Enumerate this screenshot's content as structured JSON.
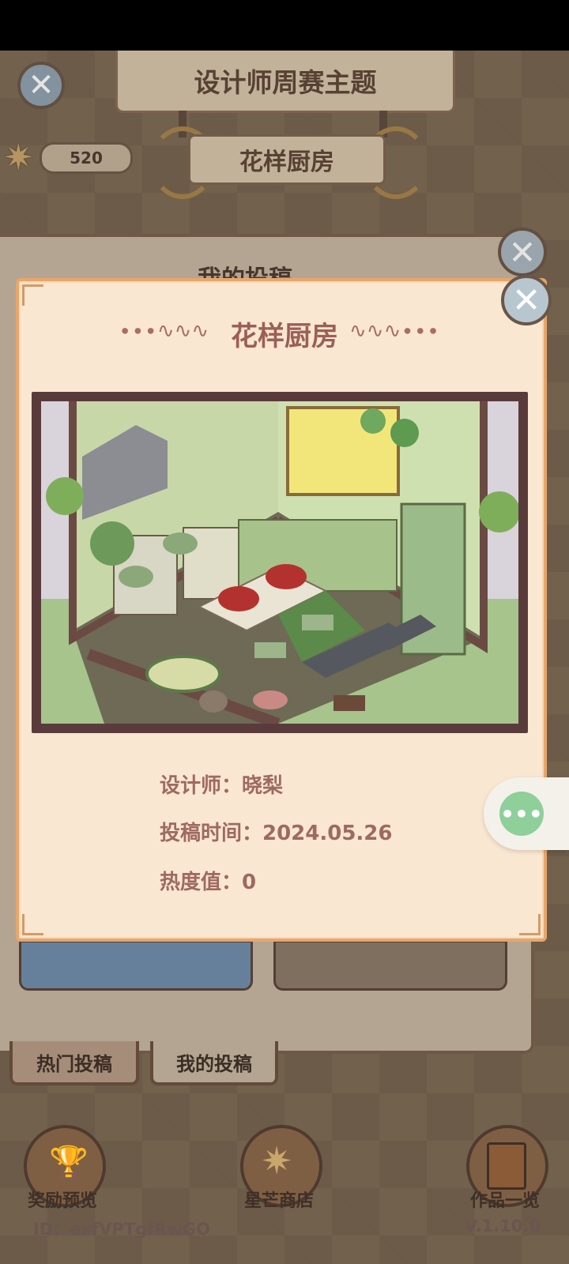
{
  "header": {
    "theme_title": "设计师周赛主题",
    "theme_name": "花样厨房",
    "star_count": "520"
  },
  "back_panel": {
    "title": "我的投稿"
  },
  "tabs": [
    {
      "label": "热门投稿",
      "active": false
    },
    {
      "label": "我的投稿",
      "active": true
    }
  ],
  "modal": {
    "title": "花样厨房",
    "designer": "设计师：晓梨",
    "submit_time": "投稿时间：2024.05.26",
    "heat": "热度值：0"
  },
  "bottom_nav": [
    {
      "label": "奖励预览",
      "icon": "trophy-icon"
    },
    {
      "label": "星芒商店",
      "icon": "star-shop-icon"
    },
    {
      "label": "作品一览",
      "icon": "book-icon"
    }
  ],
  "footer": {
    "user_id": "ID：exfVPTgfRwGO",
    "version": "V.1.10.0"
  },
  "colors": {
    "modal_bg": "#f9e7d1",
    "modal_border": "#e7a66c",
    "title_color": "#9b5f58",
    "info_color": "#9d6a62"
  }
}
